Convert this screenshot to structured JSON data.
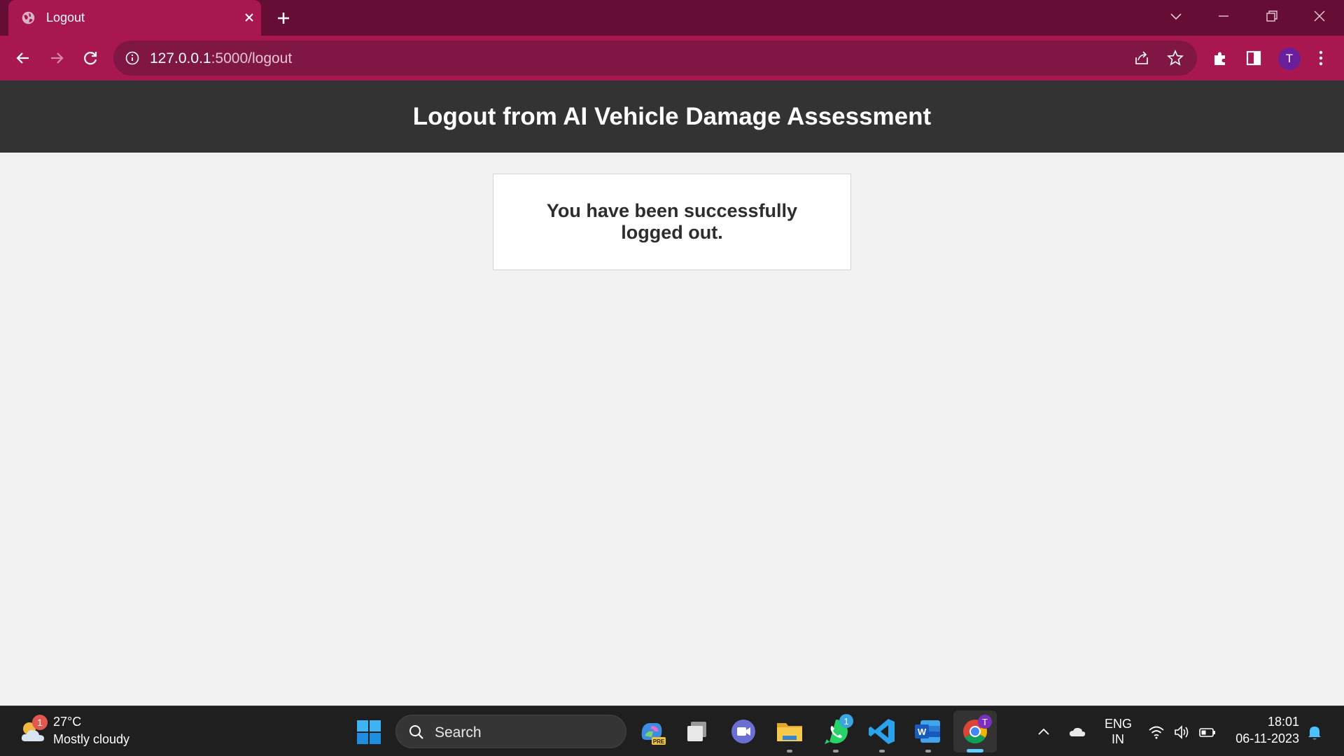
{
  "browser": {
    "tab": {
      "title": "Logout"
    },
    "address": {
      "host": "127.0.0.1",
      "path": ":5000/logout"
    },
    "profile_initial": "T"
  },
  "page": {
    "header_title": "Logout from AI Vehicle Damage Assessment",
    "message": "You have been successfully logged out."
  },
  "taskbar": {
    "weather": {
      "temp": "27°C",
      "desc": "Mostly cloudy",
      "badge": "1"
    },
    "search_label": "Search",
    "whatsapp_badge": "1",
    "chrome_profile_badge": "T",
    "copilot_badge": "PRE",
    "language": {
      "line1": "ENG",
      "line2": "IN"
    },
    "clock": {
      "time": "18:01",
      "date": "06-11-2023"
    }
  },
  "colors": {
    "tabstrip": "#650d35",
    "toolbar": "#a8174f",
    "omnibox": "#7f1643",
    "page_header": "#333333",
    "page_bg": "#f2f2f2",
    "taskbar": "#1f1f1f"
  }
}
